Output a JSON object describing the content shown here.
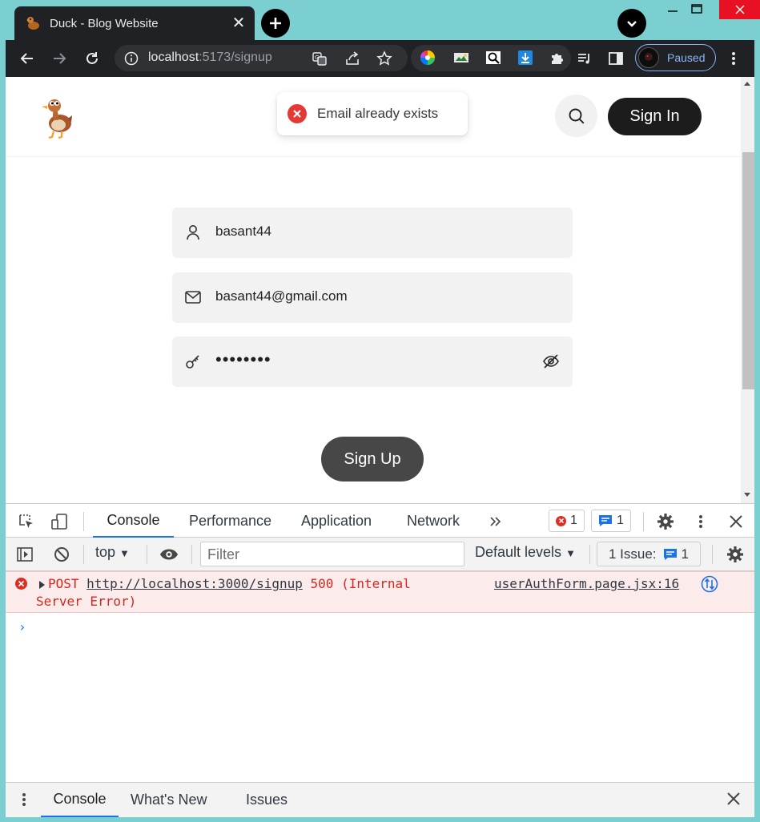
{
  "browser": {
    "tab_title": "Duck - Blog Website",
    "url_host": "localhost",
    "url_path": ":5173/signup",
    "profile_label": "Paused"
  },
  "page": {
    "toast_message": "Email already exists",
    "signin_label": "Sign In",
    "signup_label": "Sign Up",
    "fields": {
      "name_value": "basant44",
      "email_value": "basant44@gmail.com",
      "password_value": "••••••••"
    }
  },
  "devtools": {
    "tabs": [
      "Console",
      "Performance",
      "Application",
      "Network"
    ],
    "error_count": "1",
    "message_count": "1",
    "context": "top",
    "filter_placeholder": "Filter",
    "levels": "Default levels",
    "issues_label": "1 Issue:",
    "issues_count": "1",
    "error": {
      "method": "POST",
      "url": "http://localhost:3000/signup",
      "status": "500 (Internal",
      "status_cont": "Server Error)",
      "source": "userAuthForm.page.jsx:16"
    },
    "drawer_tabs": [
      "Console",
      "What's New",
      "Issues"
    ]
  },
  "colors": {
    "accent": "#1a73e8",
    "error": "#d93025",
    "button_dark": "#1c1c1c"
  }
}
